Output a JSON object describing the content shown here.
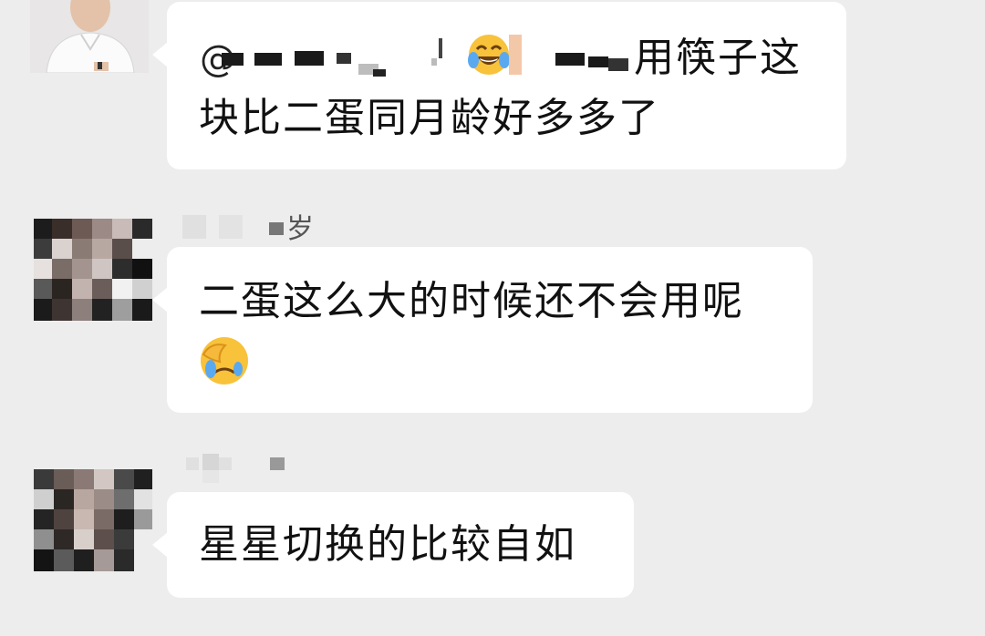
{
  "messages": [
    {
      "sender": "",
      "lines": [
        "用筷子这",
        "块比二蛋同月龄好多多了"
      ],
      "avatar": "man-in-white-shirt-avatar",
      "emoji": "tears-of-joy-emoji"
    },
    {
      "sender": "岁",
      "lines": [
        "二蛋这么大的时候还不会用呢"
      ],
      "avatar": "pixelated-avatar",
      "emoji": "face-palm-emoji"
    },
    {
      "sender": "",
      "lines": [
        "星星切换的比较自如"
      ],
      "avatar": "pixelated-avatar"
    }
  ],
  "colors": {
    "background": "#ededed",
    "bubble": "#ffffff",
    "text": "#111111"
  }
}
